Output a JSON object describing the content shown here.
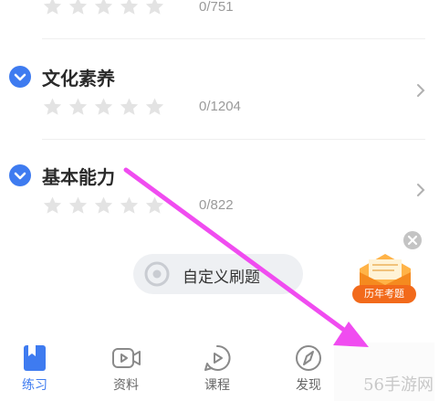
{
  "sections": [
    {
      "title": "",
      "count": "0/751"
    },
    {
      "title": "文化素养",
      "count": "0/1204"
    },
    {
      "title": "基本能力",
      "count": "0/822"
    }
  ],
  "custom_practice": {
    "label": "自定义刷题"
  },
  "promo": {
    "label": "历年考题"
  },
  "bottom_nav": [
    {
      "label": "练习",
      "icon": "book-icon",
      "active": true
    },
    {
      "label": "资料",
      "icon": "video-icon",
      "active": false
    },
    {
      "label": "课程",
      "icon": "play-icon",
      "active": false
    },
    {
      "label": "发现",
      "icon": "compass-icon",
      "active": false
    }
  ],
  "watermark": "56手游网",
  "colors": {
    "accent": "#3e7bf0",
    "star": "#e3e3e3",
    "arrow": "#f04cf0",
    "promo": "#f26a1b"
  }
}
